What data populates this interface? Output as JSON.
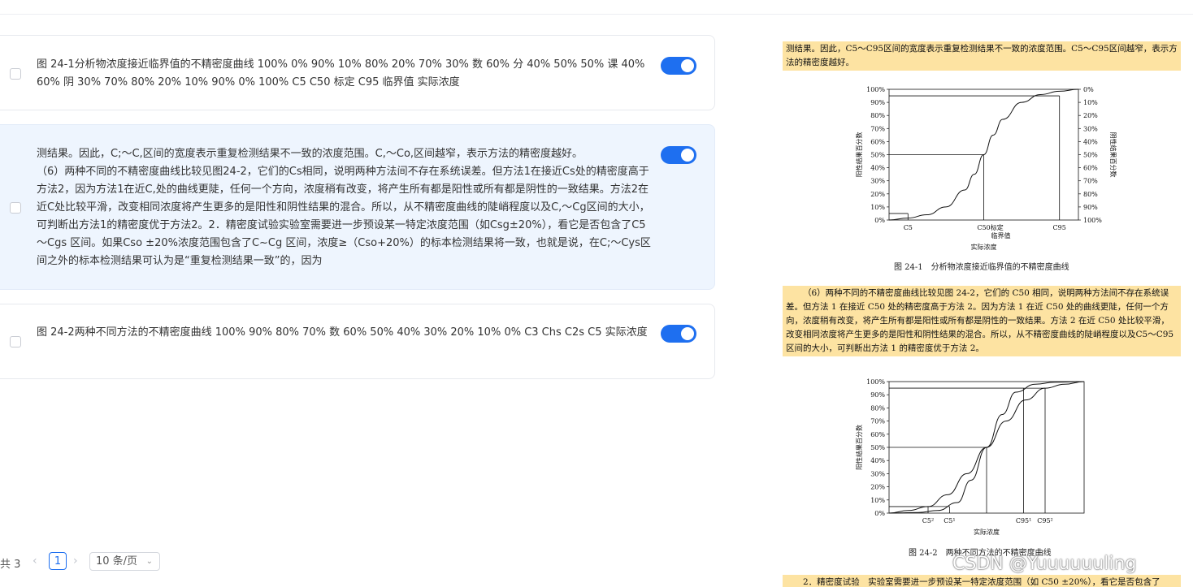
{
  "cards": [
    {
      "text": "图 24-1分析物浓度接近临界值的不精密度曲线 100% 0% 90% 10% 80% 20% 70% 30% 数 60% 分 40% 50% 50% 课 40% 60% 阴 30% 70% 80% 20% 10% 90% 0% 100% C5 C50 标定 C95 临界值 实际浓度",
      "enabled": true
    },
    {
      "text": "测结果。因此，C;～C,区间的宽度表示重复检测结果不一致的浓度范围。C,～Co,区间越窄，表示方法的精密度越好。\n（6）两种不同的不精密度曲线比较见图24-2，它们的Cs相同，说明两种方法间不存在系统误差。但方法1在接近Cs处的精密度高于方法2，因为方法1在近C,处的曲线更陡，任何一个方向，浓度稍有改变，将产生所有都是阳性或所有都是阴性的一致结果。方法2在近C处比较平滑，改变相同浓度将产生更多的是阳性和阴性结果的混合。所以，从不精密度曲线的陡峭程度以及C,～Cg区间的大小，可判断出方法1的精密度优于方法2。2．精密度试验实验室需要进一步预设某一特定浓度范围（如Csg±20%），看它是否包含了C5～Cgs 区间。如果Cso ±20%浓度范围包含了C~Cg 区间，浓度≥（Cso+20%）的标本检测结果将一致，也就是说，在C;～Cys区间之外的标本检测结果可认为是“重复检测结果一致”的，因为",
      "enabled": true
    },
    {
      "text": "图 24-2两种不同方法的不精密度曲线 100% 90% 80% 70% 数 60% 50% 40% 30% 20% 10% 0% C3 Chs C2s C5 实际浓度",
      "enabled": true
    }
  ],
  "pagination": {
    "total_label": "共 3",
    "prev_icon": "‹",
    "current_page": "1",
    "next_icon": "›",
    "page_size_label": "10 条/页",
    "page_size_icon": "⌄"
  },
  "scan": {
    "para1": "测结果。因此，C5～C95区间的宽度表示重复检测结果不一致的浓度范围。C5～C95区间越窄，表示方法的精密度越好。",
    "para2": "（6）两种不同的不精密度曲线比较见图 24-2，它们的 C50 相同，说明两种方法间不存在系统误差。但方法 1 在接近 C50 处的精密度高于方法 2。因为方法 1 在近 C50 处的曲线更陡，任何一个方向，浓度稍有改变，将产生所有都是阳性或所有都是阴性的一致结果。方法 2 在近 C50 处比较平滑，改变相同浓度将产生更多的是阳性和阴性结果的混合。所以，从不精密度曲线的陡峭程度以及C5～C95 区间的大小，可判断出方法 1 的精密度优于方法 2。",
    "para3": "2．精密度试验　实验室需要进一步预设某一特定浓度范围（如 C50 ±20%），看它是否包含了",
    "fig1_caption": "图 24-1　分析物浓度接近临界值的不精密度曲线",
    "fig2_caption": "图 24-2　两种不同方法的不精密度曲线"
  },
  "watermark": "CSDN @Yuuuuuuling",
  "chart_data": [
    {
      "type": "line",
      "title": "",
      "xlabel": "实际浓度",
      "ylabel": "阳性结果百分数",
      "ylabel_right": "阴性结果百分数",
      "yticks": [
        "0%",
        "10%",
        "20%",
        "30%",
        "40%",
        "50%",
        "60%",
        "70%",
        "80%",
        "90%",
        "100%"
      ],
      "yticks_right": [
        "100%",
        "90%",
        "80%",
        "70%",
        "60%",
        "50%",
        "40%",
        "30%",
        "20%",
        "10%",
        "0%"
      ],
      "xtick_labels": [
        "C5",
        "C50",
        "标定",
        "临界值",
        "C95"
      ],
      "ylim": [
        0,
        100
      ],
      "xlim": [
        0,
        100
      ],
      "series": [
        {
          "x": [
            0,
            10,
            20,
            30,
            40,
            45,
            50,
            55,
            60,
            70,
            80,
            90,
            100
          ],
          "values": [
            0,
            1.5,
            4,
            10,
            23,
            35,
            50,
            65,
            77,
            90,
            96,
            98.5,
            100
          ]
        }
      ],
      "reference_lines": [
        {
          "x": 10,
          "y": 5
        },
        {
          "x": 50,
          "y": 50
        },
        {
          "x": 90,
          "y": 95
        }
      ]
    },
    {
      "type": "line",
      "title": "",
      "xlabel": "实际浓度",
      "ylabel": "阳性结果百分数",
      "yticks": [
        "0%",
        "10%",
        "20%",
        "30%",
        "40%",
        "50%",
        "60%",
        "70%",
        "80%",
        "90%",
        "100%"
      ],
      "xtick_labels": [
        "C5²",
        "C5¹",
        "C95¹",
        "C95²"
      ],
      "ylim": [
        0,
        100
      ],
      "xlim": [
        0,
        100
      ],
      "series": [
        {
          "x": [
            0,
            15,
            25,
            35,
            42,
            50,
            58,
            65,
            75,
            85,
            100
          ],
          "values": [
            0,
            0.5,
            2,
            8,
            25,
            50,
            75,
            92,
            98,
            99.5,
            100
          ]
        },
        {
          "x": [
            0,
            10,
            20,
            30,
            40,
            50,
            60,
            70,
            80,
            90,
            100
          ],
          "values": [
            0,
            2,
            5,
            14,
            30,
            50,
            70,
            86,
            95,
            98,
            100
          ]
        }
      ],
      "reference_lines": [
        {
          "x": 20,
          "y": 5
        },
        {
          "x": 31,
          "y": 5
        },
        {
          "x": 50,
          "y": 50
        },
        {
          "x": 69,
          "y": 95
        },
        {
          "x": 80,
          "y": 95
        }
      ]
    }
  ]
}
